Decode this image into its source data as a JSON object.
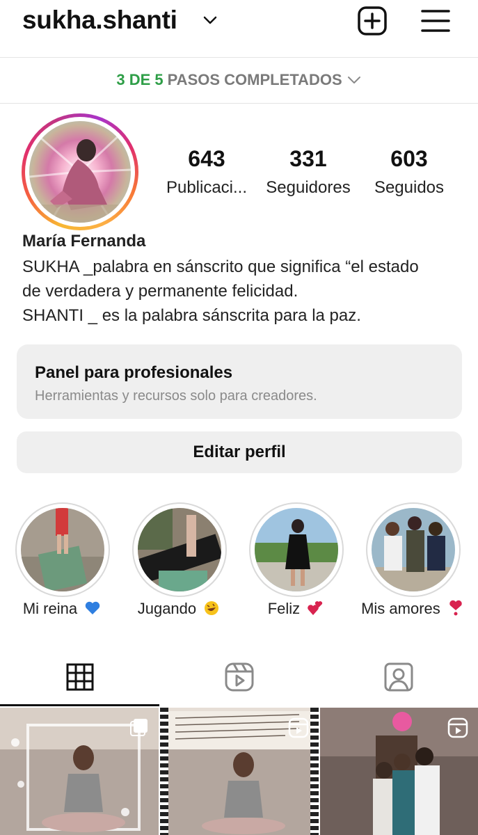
{
  "header": {
    "username": "sukha.shanti",
    "new_post_icon": "plus-square-icon",
    "menu_icon": "hamburger-menu-icon"
  },
  "steps": {
    "done": "3 DE 5",
    "rest": "PASOS COMPLETADOS"
  },
  "profile": {
    "stats": [
      {
        "value": "643",
        "label": "Publicaci..."
      },
      {
        "value": "331",
        "label": "Seguidores"
      },
      {
        "value": "603",
        "label": "Seguidos"
      }
    ],
    "name": "María Fernanda",
    "bio_lines": [
      "SUKHA _palabra en sánscrito que significa “el estado",
      "de verdadera y permanente felicidad.",
      "SHANTI _ es la palabra sánscrita para la paz."
    ]
  },
  "panel": {
    "title": "Panel para profesionales",
    "subtitle": "Herramientas y recursos solo para creadores."
  },
  "edit_profile": "Editar perfil",
  "highlights": [
    {
      "label": "Mi reina",
      "emoji": "blue-heart-icon"
    },
    {
      "label": "Jugando",
      "emoji": "rolling-laughing-icon"
    },
    {
      "label": "Feliz",
      "emoji": "two-hearts-icon"
    },
    {
      "label": "Mis amores",
      "emoji": "red-heart-exclamation-icon"
    }
  ],
  "tabs": [
    "grid-icon",
    "reels-icon",
    "tagged-icon"
  ],
  "colors": {
    "accent_green": "#2e9e47",
    "button_bg": "#efefef",
    "muted_text": "#8a8a8a"
  }
}
